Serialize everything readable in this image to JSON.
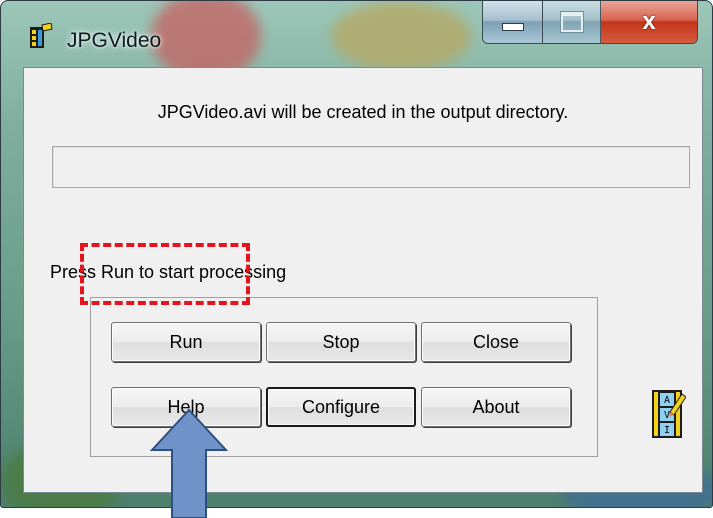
{
  "window": {
    "title": "JPGVideo",
    "icon": "film-clapper-icon"
  },
  "caption_buttons": {
    "minimize": "minimize-icon",
    "maximize": "maximize-icon",
    "close_glyph": "x"
  },
  "main": {
    "info_text": "JPGVideo.avi will be created  in the output directory.",
    "progress_percent": 0,
    "status_text": "Press Run to start processing"
  },
  "buttons": {
    "run": "Run",
    "stop": "Stop",
    "close": "Close",
    "help": "Help",
    "configure": "Configure",
    "about": "About"
  },
  "decorations": {
    "avi_icon_letters": [
      "A",
      "V",
      "I"
    ],
    "highlight_color": "#e4141e",
    "arrow_color": "#6f93c8"
  }
}
